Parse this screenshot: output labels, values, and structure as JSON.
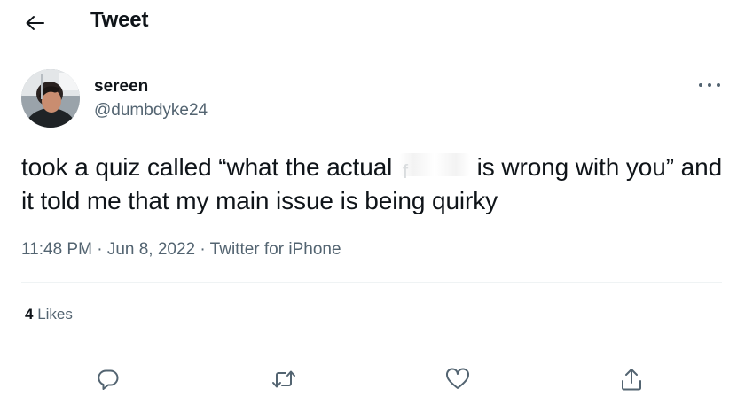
{
  "header": {
    "title": "Tweet",
    "back_icon": "arrow-left-icon"
  },
  "author": {
    "display_name": "sereen",
    "handle": "@dumbdyke24",
    "avatar_icon": "avatar"
  },
  "tweet": {
    "text_before_censor": "took a quiz called “what the actual ",
    "censored_word": "f",
    "text_after_censor": " is wrong with you” and it told me that my main issue is being quirky"
  },
  "meta": {
    "time": "11:48 PM",
    "separator_1": "·",
    "date": "Jun 8, 2022",
    "separator_2": "·",
    "source": "Twitter for iPhone"
  },
  "stats": {
    "likes_count": "4",
    "likes_label": "Likes"
  },
  "actions": {
    "reply_icon": "reply-icon",
    "retweet_icon": "retweet-icon",
    "like_icon": "heart-icon",
    "share_icon": "share-icon"
  },
  "colors": {
    "text_primary": "#0f1419",
    "text_secondary": "#536471",
    "divider": "#eff3f4",
    "background": "#ffffff"
  }
}
